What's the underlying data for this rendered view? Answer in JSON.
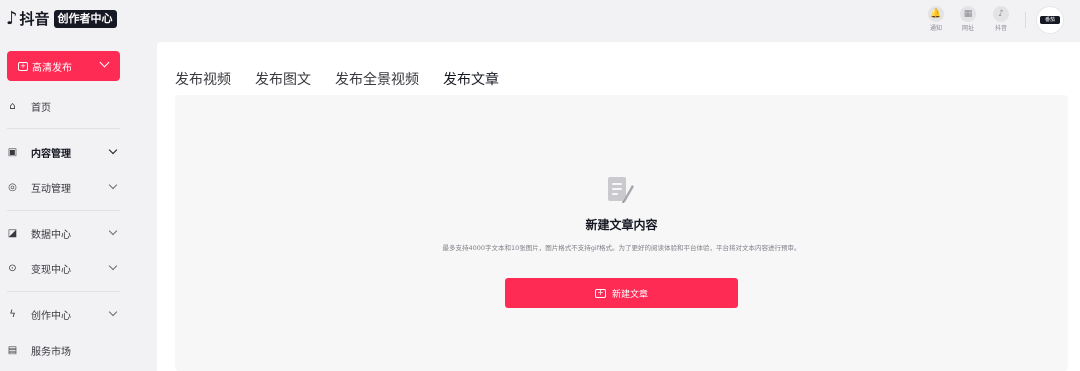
{
  "header": {
    "logo_mark": "♪",
    "logo_text": "抖音",
    "logo_badge": "创作者中心",
    "icons": [
      {
        "name": "bell-icon",
        "glyph": "🔔",
        "label": "通知"
      },
      {
        "name": "grid-icon",
        "glyph": "▦",
        "label": "网址"
      },
      {
        "name": "douyin-icon",
        "glyph": "♪",
        "label": "抖音"
      }
    ],
    "avatar_text": "番茄"
  },
  "sidebar": {
    "publish_label": "高清发布",
    "items": [
      {
        "label": "首页",
        "icon": "⌂",
        "bold": false,
        "chevron": false
      },
      {
        "label": "内容管理",
        "icon": "▣",
        "bold": true,
        "chevron": true
      },
      {
        "label": "互动管理",
        "icon": "◎",
        "bold": false,
        "chevron": true
      },
      {
        "label": "数据中心",
        "icon": "◪",
        "bold": false,
        "chevron": true
      },
      {
        "label": "变现中心",
        "icon": "⊙",
        "bold": false,
        "chevron": true
      },
      {
        "label": "创作中心",
        "icon": "ϟ",
        "bold": false,
        "chevron": true
      },
      {
        "label": "服务市场",
        "icon": "▤",
        "bold": false,
        "chevron": false
      }
    ]
  },
  "main": {
    "tabs": [
      {
        "label": "发布视频",
        "active": false
      },
      {
        "label": "发布图文",
        "active": false
      },
      {
        "label": "发布全景视频",
        "active": false
      },
      {
        "label": "发布文章",
        "active": true
      }
    ],
    "empty": {
      "title": "新建文章内容",
      "description": "最多支持4000字文本和10张图片，图片格式不支持gif格式。为了更好的阅读体验和平台体验，平台将对文本内容进行预审。",
      "button_label": "新建文章"
    }
  },
  "colors": {
    "accent": "#fe2c55",
    "background": "#f2f2f4",
    "panel": "#ffffff"
  }
}
